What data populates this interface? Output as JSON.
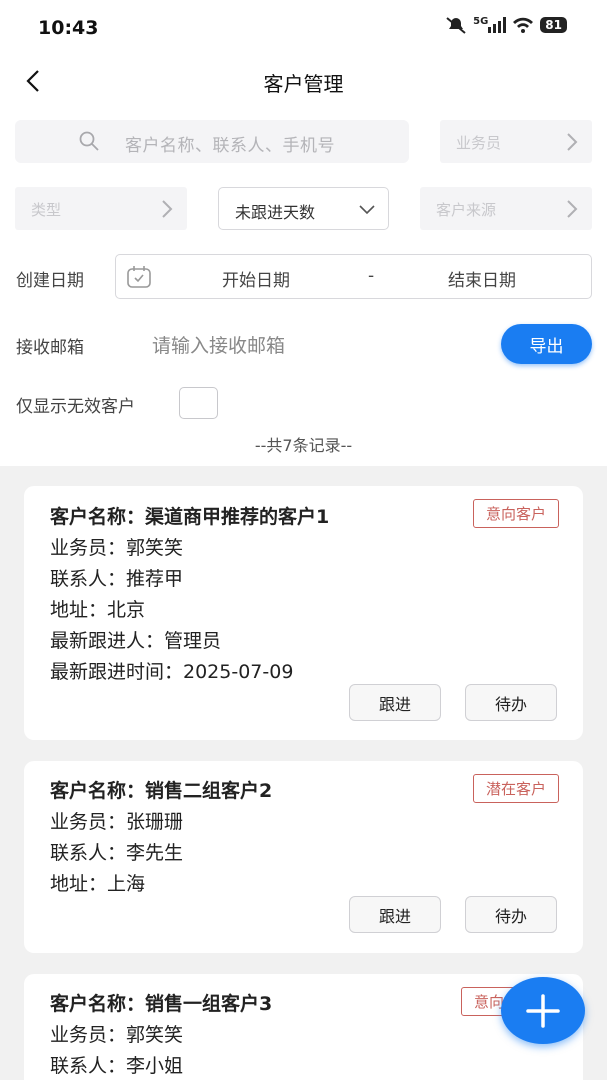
{
  "status": {
    "time": "10:43",
    "battery": "81",
    "network": "5G"
  },
  "nav": {
    "title": "客户管理"
  },
  "filters": {
    "search_placeholder": "客户名称、联系人、手机号",
    "salesperson": "业务员",
    "type": "类型",
    "days_dropdown": "未跟进天数",
    "source": "客户来源",
    "created_label": "创建日期",
    "date_start": "开始日期",
    "date_sep": "-",
    "date_end": "结束日期",
    "email_label": "接收邮箱",
    "email_placeholder": "请输入接收邮箱",
    "export": "导出",
    "invalid_only_label": "仅显示无效客户"
  },
  "record_count": "--共7条记录--",
  "actions": {
    "follow": "跟进",
    "todo": "待办"
  },
  "customers": [
    {
      "name_line": "客户名称：渠道商甲推荐的客户1",
      "tag": "意向客户",
      "salesperson": "业务员：郭笑笑",
      "contact": "联系人：推荐甲",
      "address": "地址：北京",
      "latest_follower": "最新跟进人：管理员",
      "latest_time": "最新跟进时间：2025-07-09"
    },
    {
      "name_line": "客户名称：销售二组客户2",
      "tag": "潜在客户",
      "salesperson": "业务员：张珊珊",
      "contact": "联系人：李先生",
      "address": "地址：上海"
    },
    {
      "name_line": "客户名称：销售一组客户3",
      "tag": "意向",
      "salesperson": "业务员：郭笑笑",
      "contact": "联系人：李小姐"
    }
  ],
  "colors": {
    "accent": "#1a7df2",
    "tag_red": "#c9625c",
    "list_bg": "#f1f1f1"
  }
}
